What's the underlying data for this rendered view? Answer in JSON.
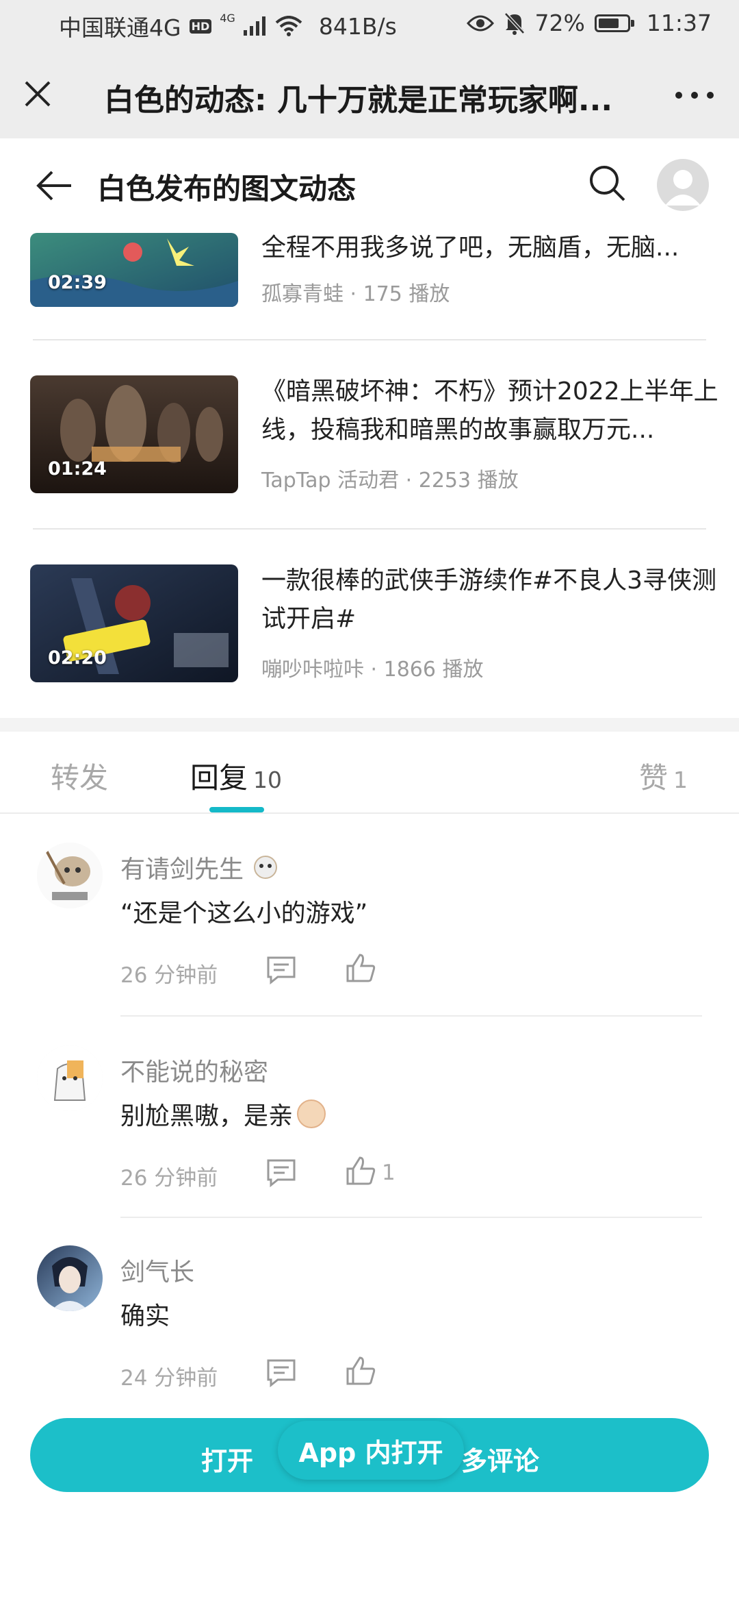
{
  "status_bar": {
    "carrier": "中国联通4G",
    "hd": "HD",
    "net_type": "4G",
    "speed": "841B/s",
    "battery": "72%",
    "battery_level": 0.72,
    "time": "11:37"
  },
  "webview": {
    "title": "白色的动态: 几十万就是正常玩家啊..."
  },
  "header": {
    "title": "白色发布的图文动态"
  },
  "videos": [
    {
      "duration": "02:39",
      "title": "全程不用我多说了吧，无脑盾，无脑...",
      "author": "孤寡青蛙",
      "plays": "175 播放"
    },
    {
      "duration": "01:24",
      "title": "《暗黑破坏神：不朽》预计2022上半年上线，投稿我和暗黑的故事赢取万元...",
      "author": "TapTap 活动君",
      "plays": "2253 播放"
    },
    {
      "duration": "02:20",
      "title": "一款很棒的武侠手游续作#不良人3寻侠测试开启#",
      "author": "嘣吵咔啦咔",
      "plays": "1866 播放"
    }
  ],
  "tabs": {
    "repost": "转发",
    "reply": "回复",
    "reply_count": "10",
    "like": "赞",
    "like_count": "1"
  },
  "comments": [
    {
      "name": "有请剑先生",
      "text": "“还是个这么小的游戏”",
      "time": "26 分钟前",
      "likes": ""
    },
    {
      "name": "不能说的秘密",
      "text": "别尬黑嗷，是亲",
      "time": "26 分钟前",
      "likes": "1"
    },
    {
      "name": "剑气长",
      "text": "确实",
      "time": "24 分钟前",
      "likes": ""
    }
  ],
  "open_bar": {
    "left": "打开",
    "right": "多评论",
    "pill": "App 内打开"
  },
  "colors": {
    "accent": "#14b9c8",
    "button": "#1cbfc9"
  }
}
